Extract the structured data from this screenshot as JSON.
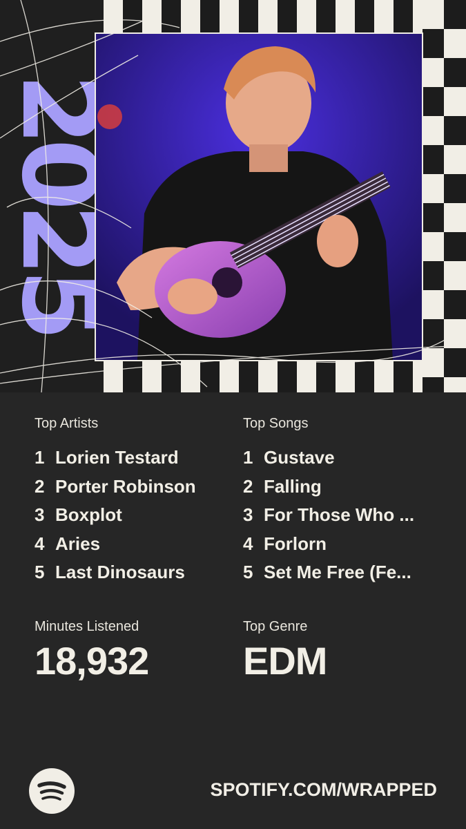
{
  "year_graphic": "2025",
  "colors": {
    "accent": "#a39bf5",
    "background": "#262626",
    "cream": "#f1eee6"
  },
  "photo": {
    "description_icon": "artist-photo-guitarist"
  },
  "top_artists": {
    "heading": "Top Artists",
    "items": [
      {
        "rank": "1",
        "name": "Lorien Testard"
      },
      {
        "rank": "2",
        "name": "Porter Robinson"
      },
      {
        "rank": "3",
        "name": "Boxplot"
      },
      {
        "rank": "4",
        "name": "Aries"
      },
      {
        "rank": "5",
        "name": "Last Dinosaurs"
      }
    ]
  },
  "top_songs": {
    "heading": "Top Songs",
    "items": [
      {
        "rank": "1",
        "name": "Gustave"
      },
      {
        "rank": "2",
        "name": "Falling"
      },
      {
        "rank": "3",
        "name": "For Those Who ..."
      },
      {
        "rank": "4",
        "name": "Forlorn"
      },
      {
        "rank": "5",
        "name": "Set Me Free (Fe..."
      }
    ]
  },
  "minutes": {
    "label": "Minutes Listened",
    "value": "18,932"
  },
  "genre": {
    "label": "Top Genre",
    "value": "EDM"
  },
  "footer": {
    "url": "SPOTIFY.COM/WRAPPED",
    "logo_icon": "spotify-logo-icon"
  }
}
